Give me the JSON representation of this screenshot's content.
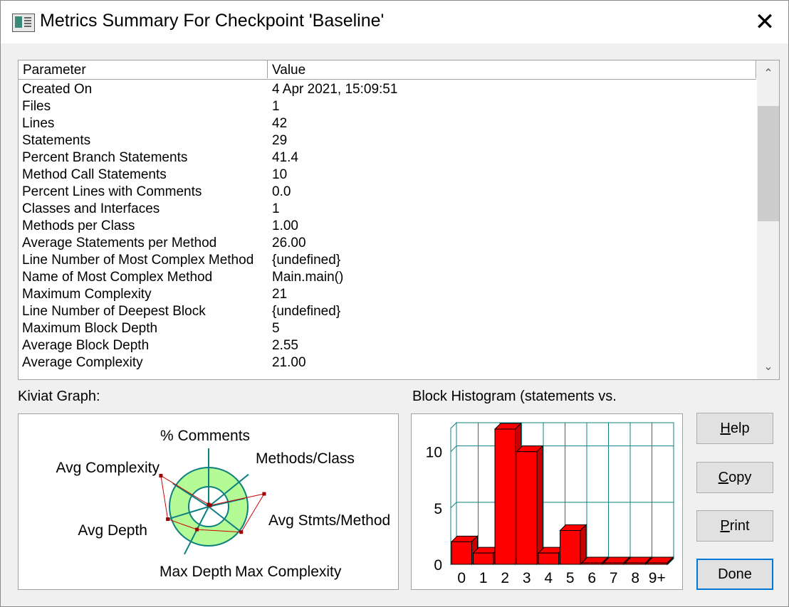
{
  "window": {
    "title": "Metrics Summary For Checkpoint 'Baseline'"
  },
  "grid": {
    "columns": [
      "Parameter",
      "Value"
    ],
    "rows": [
      [
        "Created On",
        "4 Apr 2021, 15:09:51"
      ],
      [
        "Files",
        "1"
      ],
      [
        "Lines",
        "42"
      ],
      [
        "Statements",
        "29"
      ],
      [
        "Percent Branch Statements",
        "41.4"
      ],
      [
        "Method Call Statements",
        "10"
      ],
      [
        "Percent Lines with Comments",
        "0.0"
      ],
      [
        "Classes and Interfaces",
        "1"
      ],
      [
        "Methods per Class",
        "1.00"
      ],
      [
        "Average Statements per Method",
        "26.00"
      ],
      [
        "Line Number of Most Complex Method",
        "{undefined}"
      ],
      [
        "Name of Most Complex Method",
        "Main.main()"
      ],
      [
        "Maximum Complexity",
        "21"
      ],
      [
        "Line Number of Deepest Block",
        "{undefined}"
      ],
      [
        "Maximum Block Depth",
        "5"
      ],
      [
        "Average Block Depth",
        "2.55"
      ],
      [
        "Average Complexity",
        "21.00"
      ]
    ]
  },
  "kiviat": {
    "label": "Kiviat Graph:",
    "axes": [
      "% Comments",
      "Methods/Class",
      "Avg Stmts/Method",
      "Max Complexity",
      "Max Depth",
      "Avg Depth",
      "Avg Complexity"
    ],
    "colors": {
      "band": "#b4fb96",
      "rings": "#0e8080",
      "spokes": "#0e8080",
      "polygon": "#cc0000"
    }
  },
  "histogram": {
    "label": "Block Histogram (statements vs.",
    "bar_color": "#ff0000",
    "grid_color": "#0e8080"
  },
  "chart_data": {
    "type": "bar",
    "title": "Block Histogram (statements vs.",
    "categories": [
      "0",
      "1",
      "2",
      "3",
      "4",
      "5",
      "6",
      "7",
      "8",
      "9+"
    ],
    "values": [
      2,
      1,
      12,
      10,
      1,
      3,
      0,
      0,
      0,
      0
    ],
    "yticks": [
      0,
      5,
      10
    ],
    "ylim": [
      0,
      12
    ],
    "grid": true
  },
  "buttons": {
    "help": {
      "accel": "H",
      "rest": "elp"
    },
    "copy": {
      "accel": "C",
      "rest": "opy"
    },
    "print": {
      "accel": "P",
      "rest": "rint"
    },
    "done": {
      "label": "Done"
    }
  }
}
